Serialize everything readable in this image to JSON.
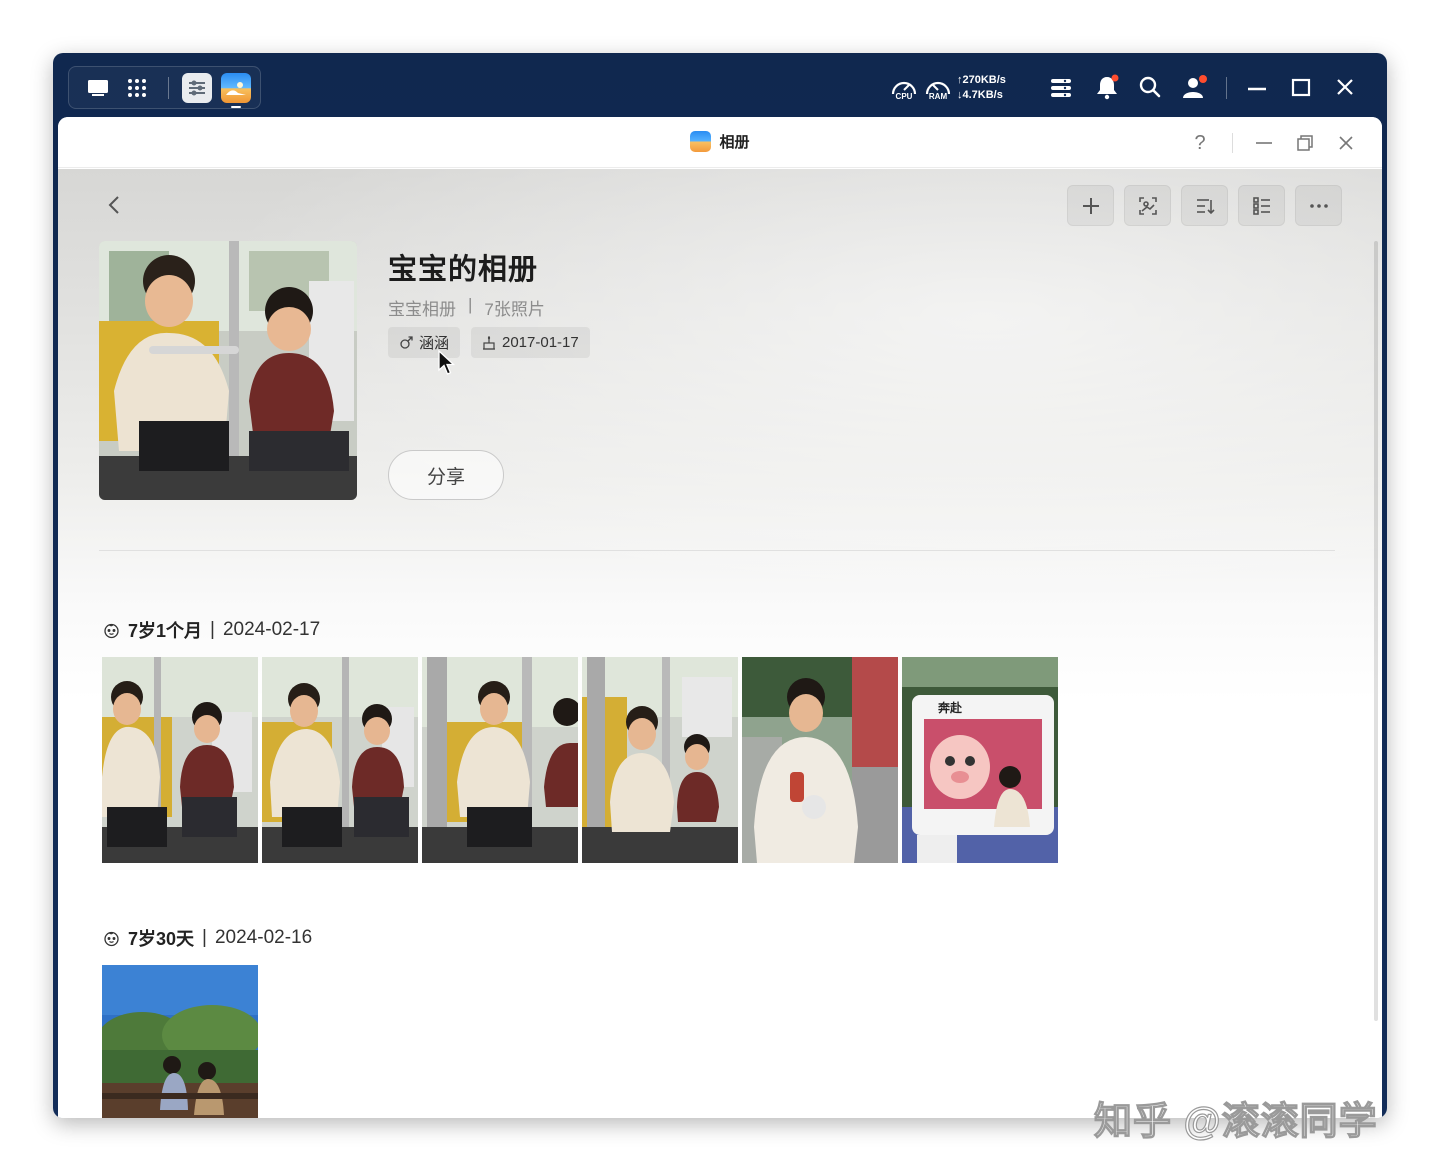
{
  "taskbar": {
    "cpu_label": "CPU",
    "ram_label": "RAM",
    "upload": "↑270KB/s",
    "download": "↓4.7KB/s"
  },
  "window": {
    "title": "相册",
    "help": "?"
  },
  "album": {
    "title": "宝宝的相册",
    "type": "宝宝相册",
    "separator": "|",
    "count": "7张照片",
    "person": "涵涵",
    "birthday": "2017-01-17",
    "share_label": "分享"
  },
  "groups": [
    {
      "age": "7岁1个月",
      "separator": "|",
      "date": "2024-02-17",
      "photo_count": 6
    },
    {
      "age": "7岁30天",
      "separator": "|",
      "date": "2024-02-16",
      "photo_count": 1
    }
  ],
  "watermark": "知乎 @滚滚同学",
  "colors": {
    "taskbar_bg": "#132d59",
    "notification_dot": "#ff4d2e",
    "app_icon_blue": "#2a8df2",
    "app_icon_orange": "#f39a3c"
  },
  "icons": [
    "desktop-icon",
    "apps-grid-icon",
    "widgets-icon",
    "photos-app-icon",
    "cpu-gauge-icon",
    "ram-gauge-icon",
    "menu-icon",
    "bell-icon",
    "search-icon",
    "user-icon",
    "minimize-icon",
    "maximize-icon",
    "close-icon",
    "back-icon",
    "plus-icon",
    "image-search-icon",
    "sort-icon",
    "list-view-icon",
    "more-icon",
    "male-icon",
    "cake-icon",
    "baby-face-icon"
  ]
}
